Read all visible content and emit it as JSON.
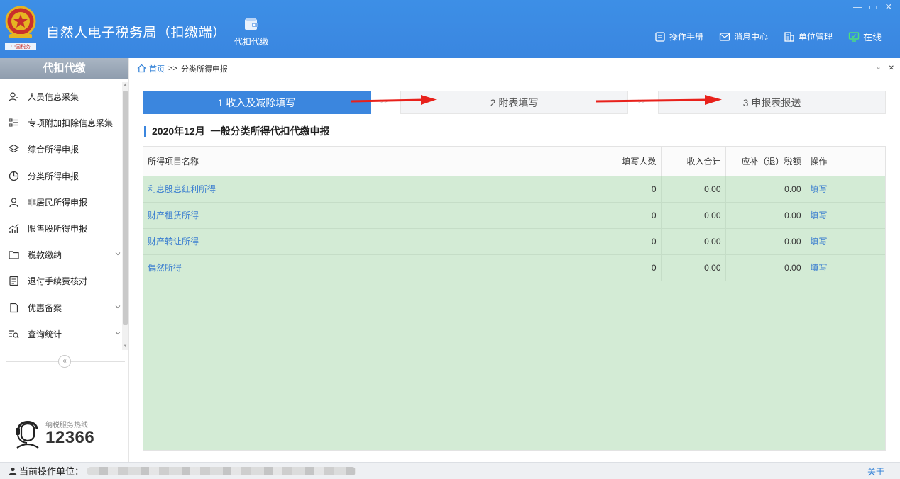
{
  "app": {
    "title": "自然人电子税务局（扣缴端）",
    "module_label": "代扣代缴",
    "window_controls": [
      "—",
      "▭",
      "✕"
    ],
    "top_links": [
      {
        "label": "操作手册",
        "icon": "manual-icon"
      },
      {
        "label": "消息中心",
        "icon": "message-icon"
      },
      {
        "label": "单位管理",
        "icon": "building-icon"
      }
    ],
    "online_status": "在线"
  },
  "sidebar": {
    "header": "代扣代缴",
    "items": [
      {
        "label": "人员信息采集",
        "icon": "person-add-icon",
        "expandable": false
      },
      {
        "label": "专项附加扣除信息采集",
        "icon": "list-icon",
        "expandable": false
      },
      {
        "label": "综合所得申报",
        "icon": "layers-icon",
        "expandable": false
      },
      {
        "label": "分类所得申报",
        "icon": "pie-chart-icon",
        "expandable": false
      },
      {
        "label": "非居民所得申报",
        "icon": "person-icon",
        "expandable": false
      },
      {
        "label": "限售股所得申报",
        "icon": "bar-chart-icon",
        "expandable": false
      },
      {
        "label": "税款缴纳",
        "icon": "folder-icon",
        "expandable": true
      },
      {
        "label": "退付手续费核对",
        "icon": "document-icon",
        "expandable": false
      },
      {
        "label": "优惠备案",
        "icon": "file-icon",
        "expandable": true
      },
      {
        "label": "查询统计",
        "icon": "search-list-icon",
        "expandable": true
      }
    ],
    "collapse_glyph": "«",
    "hotline_label": "纳税服务热线",
    "hotline_number": "12366"
  },
  "content": {
    "breadcrumb": {
      "home": "首页",
      "separator": ">>",
      "current": "分类所得申报"
    },
    "panel_controls": [
      "▫",
      "✕"
    ],
    "steps": [
      {
        "label": "1 收入及减除填写",
        "active": true
      },
      {
        "label": "2 附表填写",
        "active": false
      },
      {
        "label": "3 申报表报送",
        "active": false
      }
    ],
    "step_separator": ">>",
    "section_title": "2020年12月  一般分类所得代扣代缴申报",
    "table": {
      "headers": [
        "所得项目名称",
        "填写人数",
        "收入合计",
        "应补（退）税额",
        "操作"
      ],
      "rows": [
        {
          "name": "利息股息红利所得",
          "count": "0",
          "income": "0.00",
          "tax": "0.00",
          "action": "填写"
        },
        {
          "name": "财产租赁所得",
          "count": "0",
          "income": "0.00",
          "tax": "0.00",
          "action": "填写"
        },
        {
          "name": "财产转让所得",
          "count": "0",
          "income": "0.00",
          "tax": "0.00",
          "action": "填写"
        },
        {
          "name": "偶然所得",
          "count": "0",
          "income": "0.00",
          "tax": "0.00",
          "action": "填写"
        }
      ]
    }
  },
  "statusbar": {
    "unit_label": "当前操作单位：",
    "about": "关于"
  },
  "colors": {
    "accent": "#3b86de",
    "table_body": "#d3ebd5",
    "link": "#3c7fd0",
    "online_icon": "#4ee07a",
    "annotation_arrow": "#e8211b"
  }
}
